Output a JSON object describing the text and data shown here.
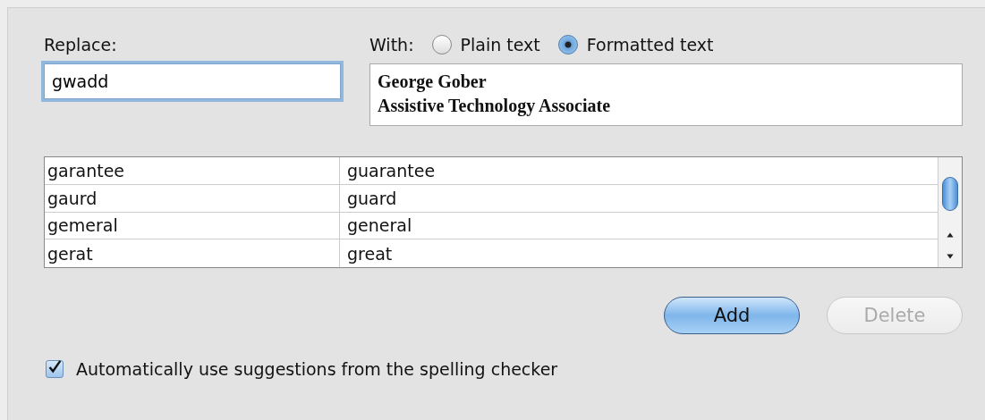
{
  "replace": {
    "label": "Replace:",
    "value": "gwadd",
    "focused": true
  },
  "with": {
    "label": "With:",
    "options": [
      {
        "label": "Plain text",
        "selected": false
      },
      {
        "label": "Formatted text",
        "selected": true
      }
    ],
    "lines": [
      "George Gober",
      "Assistive Technology Associate"
    ]
  },
  "table": {
    "rows": [
      {
        "column_1": "garantee",
        "column_2": "guarantee"
      },
      {
        "column_1": "gaurd",
        "column_2": "guard"
      },
      {
        "column_1": "gemeral",
        "column_2": "general"
      },
      {
        "column_1": "gerat",
        "column_2": "great"
      }
    ]
  },
  "buttons": [
    {
      "label": "Add",
      "default": true,
      "disabled": false
    },
    {
      "label": "Delete",
      "default": false,
      "disabled": true
    }
  ],
  "auto_suggest": {
    "label": "Automatically use suggestions from the spelling checker",
    "checked": true
  }
}
